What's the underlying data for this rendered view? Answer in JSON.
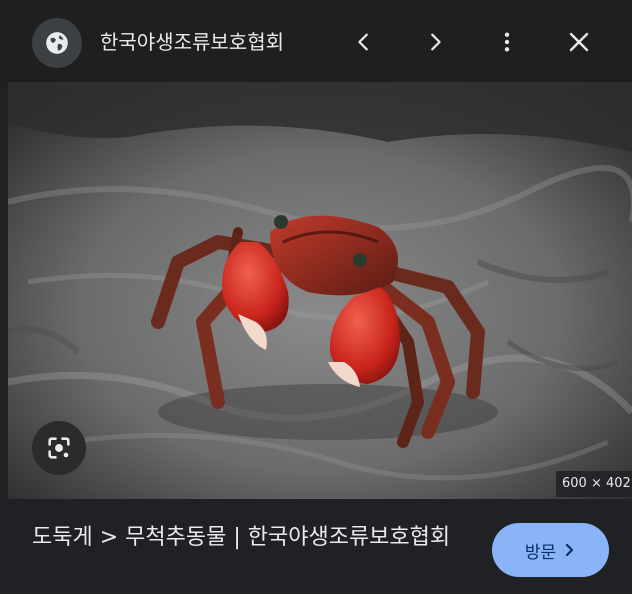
{
  "header": {
    "site_title": "한국야생조류보호협회",
    "icons": {
      "site": "globe-icon",
      "prev": "chevron-left-icon",
      "next": "chevron-right-icon",
      "more": "more-vert-icon",
      "close": "close-icon"
    }
  },
  "image": {
    "dimensions_label": "600 × 402",
    "lens_icon": "lens-search-icon"
  },
  "footer": {
    "caption": "도둑게 > 무척추동물 | 한국야생조류보호협회",
    "visit_label": "방문",
    "visit_icon": "chevron-right-icon"
  },
  "colors": {
    "background": "#202124",
    "accent": "#8ab4f8",
    "text": "#e8eaed"
  }
}
